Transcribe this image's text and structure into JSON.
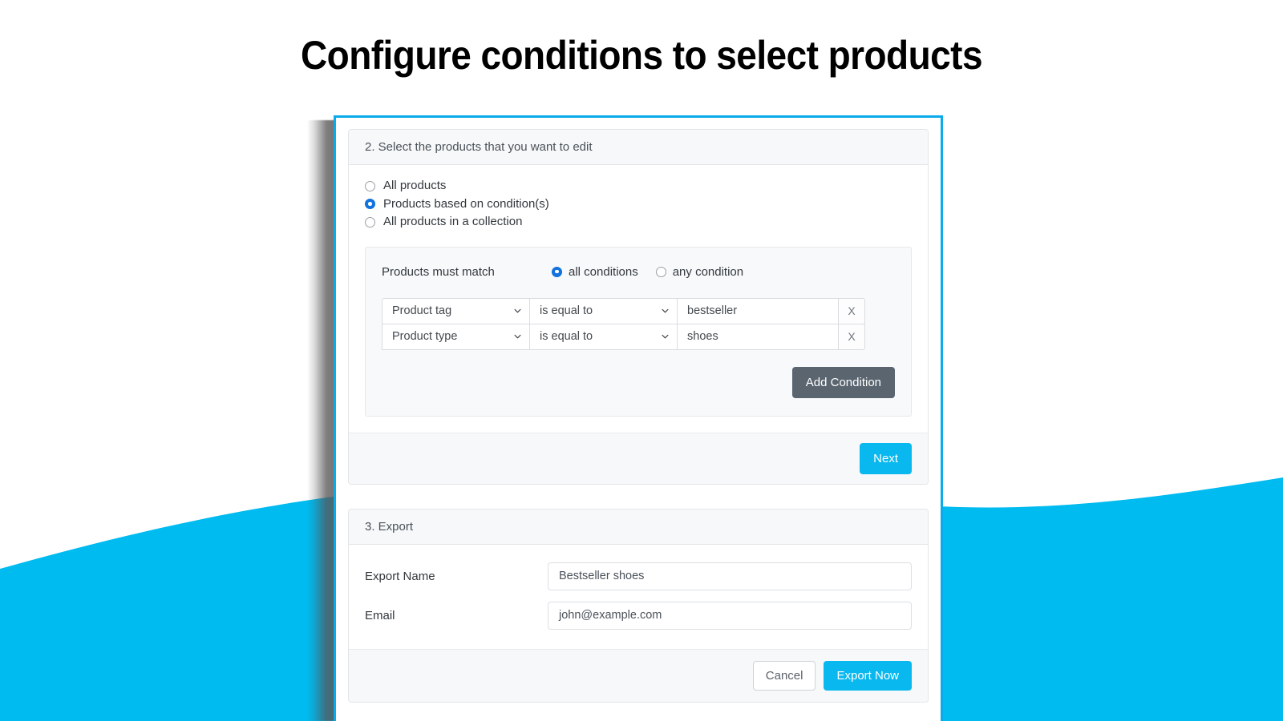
{
  "page": {
    "headline": "Configure conditions to select products",
    "background_color": "#ffffff",
    "wave_color": "#00bbf0",
    "panel_border_color": "#0aabeb"
  },
  "select_products_card": {
    "header": "2. Select the products that you want to edit",
    "scope_options": [
      {
        "label": "All products",
        "selected": false
      },
      {
        "label": "Products based on condition(s)",
        "selected": true
      },
      {
        "label": "All products in a collection",
        "selected": false
      }
    ],
    "conditions": {
      "match_label": "Products must match",
      "match_options": [
        {
          "label": "all conditions",
          "selected": true
        },
        {
          "label": "any condition",
          "selected": false
        }
      ],
      "column_remove_label": "X",
      "rows": [
        {
          "field": "Product tag",
          "operator": "is equal to",
          "value": "bestseller",
          "remove": "X"
        },
        {
          "field": "Product type",
          "operator": "is equal to",
          "value": "shoes",
          "remove": "X"
        }
      ],
      "add_condition_label": "Add Condition"
    },
    "next_label": "Next"
  },
  "export_card": {
    "header": "3. Export",
    "fields": [
      {
        "label": "Export Name",
        "value": "Bestseller shoes"
      },
      {
        "label": "Email",
        "value": "john@example.com"
      }
    ],
    "cancel_label": "Cancel",
    "export_label": "Export Now"
  }
}
